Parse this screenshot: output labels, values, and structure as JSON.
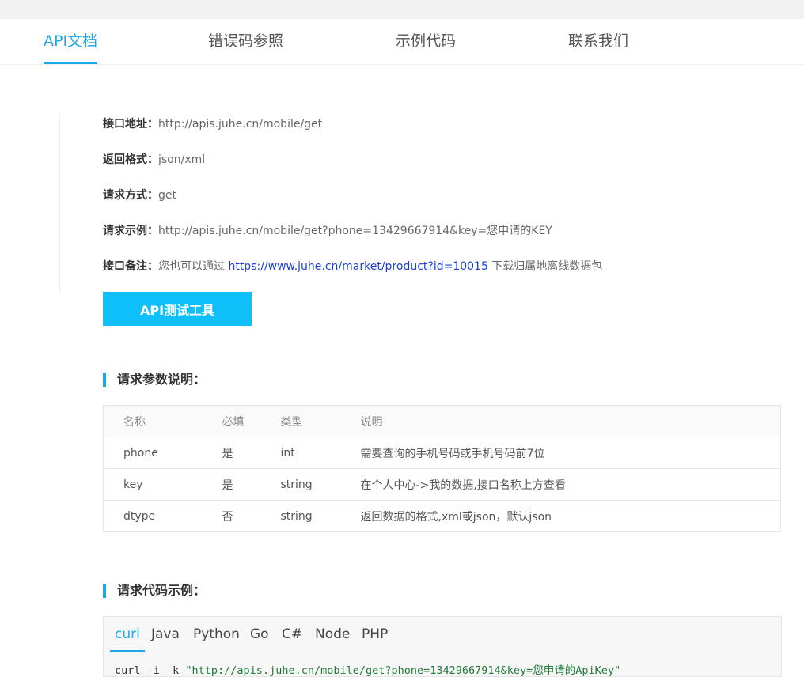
{
  "nav": {
    "tabs": [
      {
        "label": "API文档",
        "active": true
      },
      {
        "label": "错误码参照",
        "active": false
      },
      {
        "label": "示例代码",
        "active": false
      },
      {
        "label": "联系我们",
        "active": false
      }
    ]
  },
  "info": {
    "url": {
      "label": "接口地址：",
      "value": "http://apis.juhe.cn/mobile/get"
    },
    "format": {
      "label": "返回格式：",
      "value": "json/xml"
    },
    "method": {
      "label": "请求方式：",
      "value": "get"
    },
    "example": {
      "label": "请求示例：",
      "value": "http://apis.juhe.cn/mobile/get?phone=13429667914&key=您申请的KEY"
    },
    "note": {
      "label": "接口备注：",
      "prefix": "您也可以通过 ",
      "link": "https://www.juhe.cn/market/product?id=10015",
      "suffix": " 下载归属地离线数据包"
    }
  },
  "test_button": {
    "label": "API测试工具"
  },
  "params": {
    "title": "请求参数说明：",
    "headers": [
      "名称",
      "必填",
      "类型",
      "说明"
    ],
    "rows": [
      [
        "phone",
        "是",
        "int",
        "需要查询的手机号码或手机号码前7位"
      ],
      [
        "key",
        "是",
        "string",
        "在个人中心->我的数据,接口名称上方查看"
      ],
      [
        "dtype",
        "否",
        "string",
        "返回数据的格式,xml或json，默认json"
      ]
    ]
  },
  "code": {
    "title": "请求代码示例：",
    "tabs": [
      {
        "label": "curl",
        "active": true
      },
      {
        "label": "Java",
        "active": false
      },
      {
        "label": "Python",
        "active": false
      },
      {
        "label": "Go",
        "active": false
      },
      {
        "label": "C#",
        "active": false
      },
      {
        "label": "Node",
        "active": false
      },
      {
        "label": "PHP",
        "active": false
      }
    ],
    "command": "curl -i -k ",
    "string": "\"http://apis.juhe.cn/mobile/get?phone=13429667914&key=您申请的ApiKey\""
  },
  "colors": {
    "accent": "#1aa8e6",
    "button": "#0ec0f7",
    "link": "#1a3fd6"
  }
}
